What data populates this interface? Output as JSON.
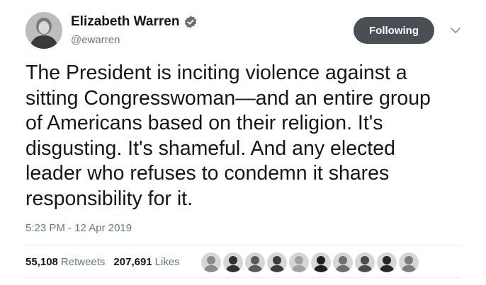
{
  "author": {
    "display_name": "Elizabeth Warren",
    "handle": "@ewarren",
    "verified": true,
    "avatar_icon": "profile-photo"
  },
  "follow_button": {
    "label": "Following"
  },
  "menu_icon": "chevron-down-icon",
  "tweet": {
    "lines": [
      "The President is inciting violence against a",
      "sitting Congresswoman—and an entire group",
      "of Americans based on their religion. It's",
      "disgusting. It's shameful. And any elected",
      "leader who refuses to condemn it shares",
      "responsibility for it."
    ],
    "timestamp": "5:23 PM - 12 Apr 2019"
  },
  "stats": {
    "retweets_count": "55,108",
    "retweets_label": "Retweets",
    "likes_count": "207,691",
    "likes_label": "Likes"
  },
  "likers": [
    {
      "color": "#8a8a8a"
    },
    {
      "color": "#2e2e2e"
    },
    {
      "color": "#5a5a5a"
    },
    {
      "color": "#3c3c3c"
    },
    {
      "color": "#a0a0a0"
    },
    {
      "color": "#1f1f1f"
    },
    {
      "color": "#6e6e6e"
    },
    {
      "color": "#4a4a4a"
    },
    {
      "color": "#262626"
    },
    {
      "color": "#7c7c7c"
    }
  ],
  "colors": {
    "text": "#14171a",
    "secondary": "#657786",
    "button_bg": "#4a4f55",
    "divider": "#e6ecf0"
  }
}
